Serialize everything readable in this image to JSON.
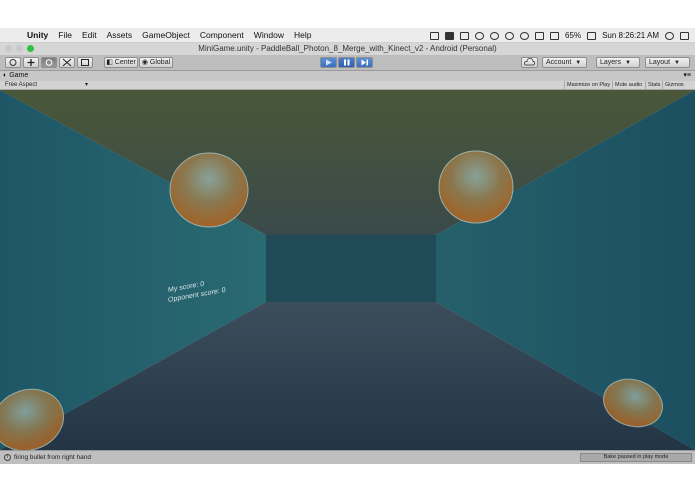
{
  "menubar": {
    "app_name": "Unity",
    "items": [
      "File",
      "Edit",
      "Assets",
      "GameObject",
      "Component",
      "Window",
      "Help"
    ],
    "battery": "65%",
    "clock": "Sun 8:26:21 AM"
  },
  "window": {
    "title": "MiniGame.unity - PaddleBall_Photon_8_Merge_with_Kinect_v2 - Android (Personal)"
  },
  "toolbar": {
    "pivot_label": "Center",
    "space_label": "Global",
    "account_label": "Account",
    "layers_label": "Layers",
    "layout_label": "Layout",
    "play_state": "playing",
    "paused": true
  },
  "game_panel": {
    "tab_label": "Game",
    "aspect_label": "Free Aspect",
    "buttons": [
      "Maximize on Play",
      "Mute audio",
      "Stats",
      "Gizmos"
    ]
  },
  "scene": {
    "score_line_1": "My score: 0",
    "score_line_2": "Opponent score: 0"
  },
  "status": {
    "message": "firing bullet from right hand",
    "right_text": "Bake paused in play mode"
  },
  "colors": {
    "play_blue": "#3a6fc0",
    "floor": "#2a3e50",
    "ceiling": "#4e5a3e",
    "wall": "#1f5360",
    "far_wall": "#1e4a55",
    "ball_top": "#7fa8a6",
    "ball_bottom": "#a8702a"
  }
}
